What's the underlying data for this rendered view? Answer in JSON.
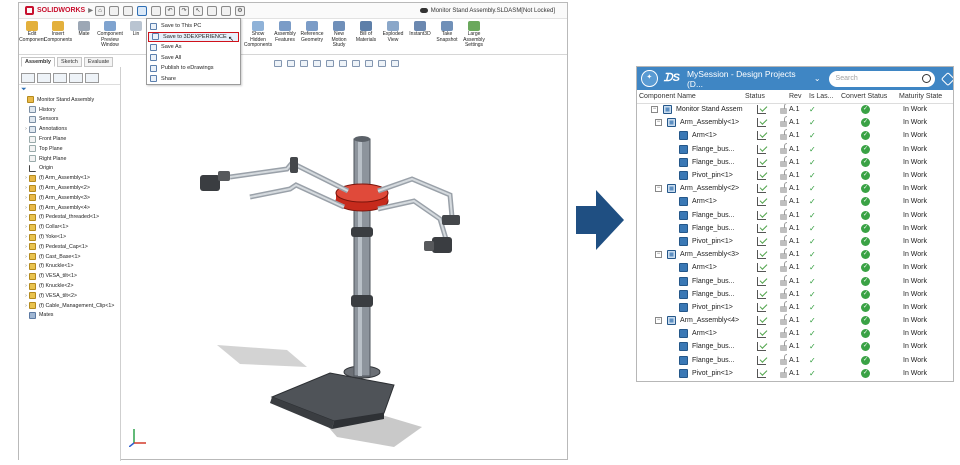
{
  "solidworks": {
    "logo_text": "SOLIDWORKS",
    "doc_title": "Monitor Stand Assembly.SLDASM[Not Locked]",
    "ribbon": [
      {
        "label": "Edit Component",
        "color": "#e3b03c"
      },
      {
        "label": "Insert Components",
        "color": "#e3b03c"
      },
      {
        "label": "Mate",
        "color": "#9ca7b5"
      },
      {
        "label": "Component Preview Window",
        "color": "#7fa3cf"
      },
      {
        "label": "Lin",
        "color": "#b9c4d1"
      }
    ],
    "ribbon_right": [
      {
        "label": "Show Hidden Components",
        "color": "#8fb2d8"
      },
      {
        "label": "Assembly Features",
        "color": "#7b9cc7"
      },
      {
        "label": "Reference Geometry",
        "color": "#7b9cc7"
      },
      {
        "label": "New Motion Study",
        "color": "#6f8fb9"
      },
      {
        "label": "Bill of Materials",
        "color": "#5d7fa9"
      },
      {
        "label": "Exploded View",
        "color": "#8aa7c9"
      },
      {
        "label": "Instant3D",
        "color": "#6b88b0"
      },
      {
        "label": "Take Snapshot",
        "color": "#7090b8"
      },
      {
        "label": "Large Assembly Settings",
        "color": "#6aa85c"
      }
    ],
    "tabs": [
      "Assembly",
      "Sketch",
      "Evaluate"
    ],
    "save_menu": [
      "Save to This PC",
      "Save to 3DEXPERIENCE",
      "Save As",
      "Save All",
      "Publish to eDrawings",
      "Share"
    ],
    "tree": [
      {
        "label": "Monitor Stand Assembly",
        "icon": "assembly",
        "indent": 0,
        "exp": ""
      },
      {
        "label": "History",
        "icon": "feature",
        "indent": 1,
        "exp": ""
      },
      {
        "label": "Sensors",
        "icon": "feature",
        "indent": 1,
        "exp": ""
      },
      {
        "label": "Annotations",
        "icon": "feature",
        "indent": 1,
        "exp": "›"
      },
      {
        "label": "Front Plane",
        "icon": "plane",
        "indent": 1,
        "exp": ""
      },
      {
        "label": "Top Plane",
        "icon": "plane",
        "indent": 1,
        "exp": ""
      },
      {
        "label": "Right Plane",
        "icon": "plane",
        "indent": 1,
        "exp": ""
      },
      {
        "label": "Origin",
        "icon": "origin",
        "indent": 1,
        "exp": ""
      },
      {
        "label": "(f) Arm_Assembly<1>",
        "icon": "assembly",
        "indent": 1,
        "exp": "›"
      },
      {
        "label": "(f) Arm_Assembly<2>",
        "icon": "assembly",
        "indent": 1,
        "exp": "›"
      },
      {
        "label": "(f) Arm_Assembly<3>",
        "icon": "assembly",
        "indent": 1,
        "exp": "›"
      },
      {
        "label": "(f) Arm_Assembly<4>",
        "icon": "assembly",
        "indent": 1,
        "exp": "›"
      },
      {
        "label": "(f) Pedestal_threaded<1>",
        "icon": "part",
        "indent": 1,
        "exp": "›"
      },
      {
        "label": "(f) Collar<1>",
        "icon": "part",
        "indent": 1,
        "exp": "›"
      },
      {
        "label": "(f) Yoke<1>",
        "icon": "part",
        "indent": 1,
        "exp": "›"
      },
      {
        "label": "(f) Pedestal_Cap<1>",
        "icon": "part",
        "indent": 1,
        "exp": "›"
      },
      {
        "label": "(f) Cast_Base<1>",
        "icon": "part",
        "indent": 1,
        "exp": "›"
      },
      {
        "label": "(f) Knuckle<1>",
        "icon": "part",
        "indent": 1,
        "exp": "›"
      },
      {
        "label": "(f) VESA_tilt<1>",
        "icon": "part",
        "indent": 1,
        "exp": "›"
      },
      {
        "label": "(f) Knuckle<2>",
        "icon": "part",
        "indent": 1,
        "exp": "›"
      },
      {
        "label": "(f) VESA_tilt<2>",
        "icon": "part",
        "indent": 1,
        "exp": "›"
      },
      {
        "label": "(f) Cable_Management_Clip<1>",
        "icon": "part",
        "indent": 1,
        "exp": "›"
      },
      {
        "label": "Mates",
        "icon": "mates",
        "indent": 1,
        "exp": ""
      }
    ]
  },
  "panel": {
    "session_title": "MySession - Design Projects (D...",
    "search_placeholder": "Search",
    "columns": [
      "Component Name",
      "Status",
      "Rev",
      "Is Las...",
      "Convert Status",
      "Maturity State"
    ],
    "rows": [
      {
        "name": "Monitor Stand Assem...",
        "level": 0,
        "type": "assembly",
        "rev": "A.1",
        "maturity": "In Work"
      },
      {
        "name": "Arm_Assembly<1>",
        "level": 1,
        "type": "assembly",
        "rev": "A.1",
        "maturity": "In Work"
      },
      {
        "name": "Arm<1>",
        "level": 2,
        "type": "part",
        "rev": "A.1",
        "maturity": "In Work"
      },
      {
        "name": "Flange_bus...",
        "level": 2,
        "type": "part",
        "rev": "A.1",
        "maturity": "In Work"
      },
      {
        "name": "Flange_bus...",
        "level": 2,
        "type": "part",
        "rev": "A.1",
        "maturity": "In Work"
      },
      {
        "name": "Pivot_pin<1>",
        "level": 2,
        "type": "part",
        "rev": "A.1",
        "maturity": "In Work"
      },
      {
        "name": "Arm_Assembly<2>",
        "level": 1,
        "type": "assembly",
        "rev": "A.1",
        "maturity": "In Work"
      },
      {
        "name": "Arm<1>",
        "level": 2,
        "type": "part",
        "rev": "A.1",
        "maturity": "In Work"
      },
      {
        "name": "Flange_bus...",
        "level": 2,
        "type": "part",
        "rev": "A.1",
        "maturity": "In Work"
      },
      {
        "name": "Flange_bus...",
        "level": 2,
        "type": "part",
        "rev": "A.1",
        "maturity": "In Work"
      },
      {
        "name": "Pivot_pin<1>",
        "level": 2,
        "type": "part",
        "rev": "A.1",
        "maturity": "In Work"
      },
      {
        "name": "Arm_Assembly<3>",
        "level": 1,
        "type": "assembly",
        "rev": "A.1",
        "maturity": "In Work"
      },
      {
        "name": "Arm<1>",
        "level": 2,
        "type": "part",
        "rev": "A.1",
        "maturity": "In Work"
      },
      {
        "name": "Flange_bus...",
        "level": 2,
        "type": "part",
        "rev": "A.1",
        "maturity": "In Work"
      },
      {
        "name": "Flange_bus...",
        "level": 2,
        "type": "part",
        "rev": "A.1",
        "maturity": "In Work"
      },
      {
        "name": "Pivot_pin<1>",
        "level": 2,
        "type": "part",
        "rev": "A.1",
        "maturity": "In Work"
      },
      {
        "name": "Arm_Assembly<4>",
        "level": 1,
        "type": "assembly",
        "rev": "A.1",
        "maturity": "In Work"
      },
      {
        "name": "Arm<1>",
        "level": 2,
        "type": "part",
        "rev": "A.1",
        "maturity": "In Work"
      },
      {
        "name": "Flange_bus...",
        "level": 2,
        "type": "part",
        "rev": "A.1",
        "maturity": "In Work"
      },
      {
        "name": "Flange_bus...",
        "level": 2,
        "type": "part",
        "rev": "A.1",
        "maturity": "In Work"
      },
      {
        "name": "Pivot_pin<1>",
        "level": 2,
        "type": "part",
        "rev": "A.1",
        "maturity": "In Work"
      }
    ]
  },
  "colors": {
    "accent_blue": "#3f86c4",
    "arrow_blue": "#1f4f82",
    "highlight_red": "#d0121b",
    "ok_green": "#3aa245"
  }
}
